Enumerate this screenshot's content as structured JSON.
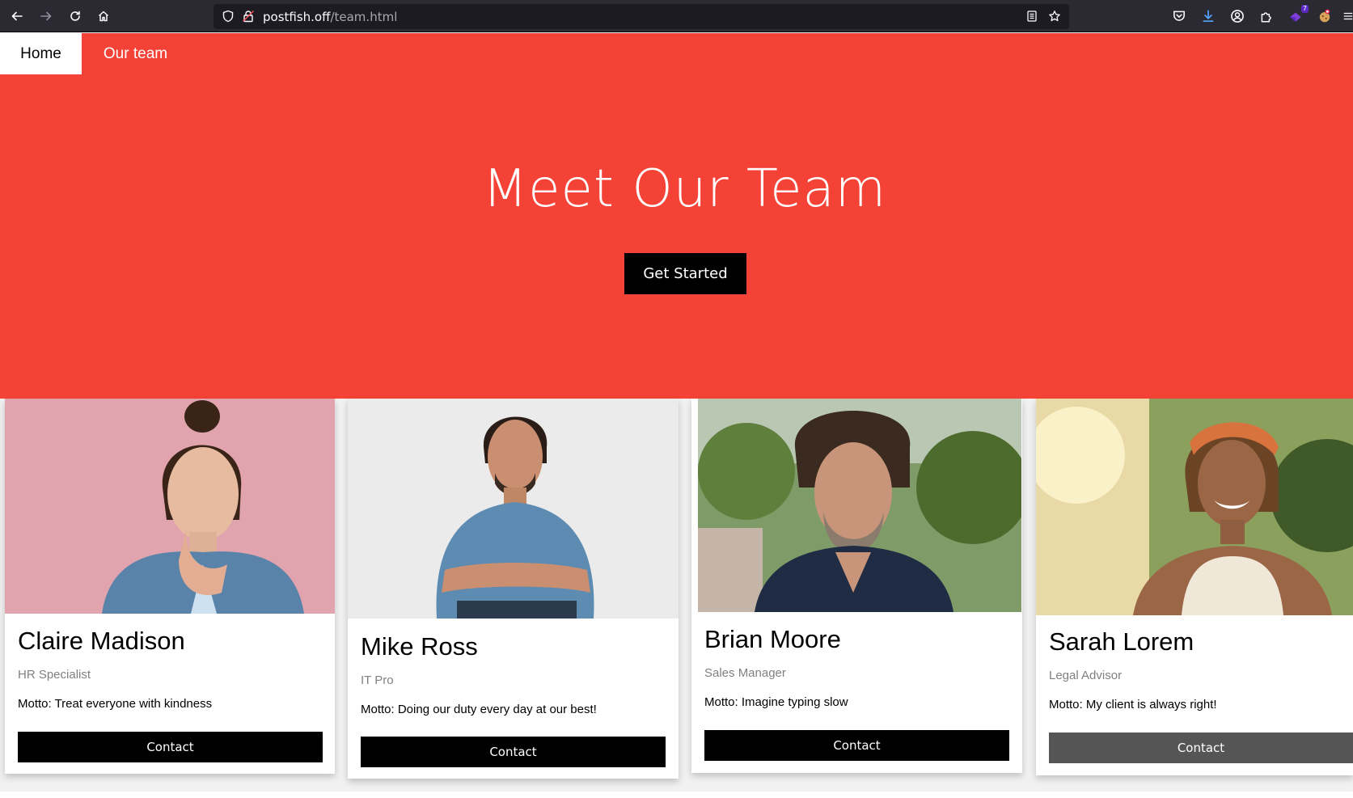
{
  "browser": {
    "url_host": "postfish.off",
    "url_path": "/team.html",
    "extension_badge": "7"
  },
  "nav": {
    "home": "Home",
    "team": "Our team"
  },
  "hero": {
    "title": "Meet Our Team",
    "button": "Get Started"
  },
  "team": [
    {
      "name": "Claire Madison",
      "role": "HR Specialist",
      "motto": "Motto: Treat everyone with kindness",
      "contact": "Contact"
    },
    {
      "name": "Mike Ross",
      "role": "IT Pro",
      "motto": "Motto: Doing our duty every day at our best!",
      "contact": "Contact"
    },
    {
      "name": "Brian Moore",
      "role": "Sales Manager",
      "motto": "Motto: Imagine typing slow",
      "contact": "Contact"
    },
    {
      "name": "Sarah Lorem",
      "role": "Legal Advisor",
      "motto": "Motto: My client is always right!",
      "contact": "Contact"
    }
  ],
  "colors": {
    "brand_red": "#f44336",
    "button_black": "#000000",
    "button_hover": "#555555"
  }
}
